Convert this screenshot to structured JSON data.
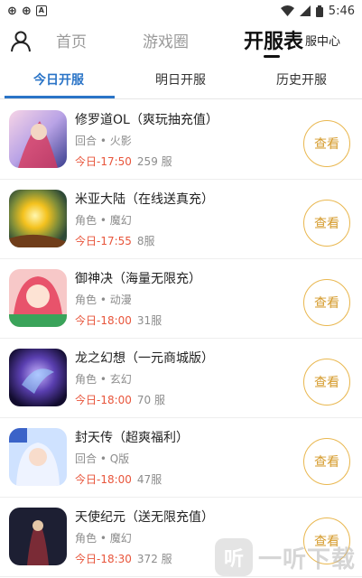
{
  "status_bar": {
    "glyphs": [
      "⊕",
      "⊕"
    ],
    "notification_letter": "A",
    "time": "5:46"
  },
  "top_nav": {
    "tabs": [
      {
        "label": "首页"
      },
      {
        "label": "游戏圈"
      },
      {
        "label": "开服表",
        "active": true
      },
      {
        "label": "服中心"
      }
    ]
  },
  "sub_tabs": [
    {
      "label": "今日开服",
      "active": true
    },
    {
      "label": "明日开服"
    },
    {
      "label": "历史开服"
    }
  ],
  "servers": [
    {
      "name": "修罗道OL（爽玩抽充值）",
      "tags": "回合 • 火影",
      "time": "今日-17:50",
      "server": "259 服",
      "button": "查看"
    },
    {
      "name": "米亚大陆（在线送真充）",
      "tags": "角色 • 魔幻",
      "time": "今日-17:55",
      "server": "8服",
      "button": "查看"
    },
    {
      "name": "御神决（海量无限充）",
      "tags": "角色 • 动漫",
      "time": "今日-18:00",
      "server": "31服",
      "button": "查看"
    },
    {
      "name": "龙之幻想（一元商城版）",
      "tags": "角色 • 玄幻",
      "time": "今日-18:00",
      "server": "70 服",
      "button": "查看"
    },
    {
      "name": "封天传（超爽福利）",
      "tags": "回合 • Q版",
      "time": "今日-18:00",
      "server": "47服",
      "button": "查看"
    },
    {
      "name": "天使纪元（送无限充值）",
      "tags": "角色 • 魔幻",
      "time": "今日-18:30",
      "server": "372 服",
      "button": "查看"
    }
  ],
  "watermark": {
    "logo": "听",
    "text": "一听下载"
  },
  "colors": {
    "accent_blue": "#2a74c7",
    "time_red": "#e8553b",
    "button_gold": "#e9b74f"
  }
}
